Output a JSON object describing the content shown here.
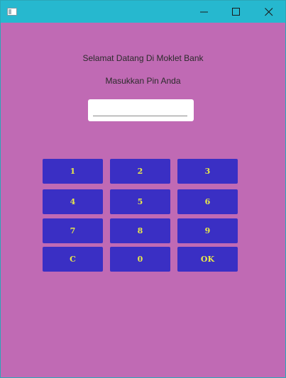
{
  "window": {
    "icon": "app-window-icon",
    "controls": [
      "minimize-icon",
      "maximize-icon",
      "close-icon"
    ]
  },
  "screen": {
    "welcome": "Selamat Datang Di Moklet Bank",
    "prompt": "Masukkan Pin Anda",
    "pin_value": ""
  },
  "keypad": {
    "k1": "1",
    "k2": "2",
    "k3": "3",
    "k4": "4",
    "k5": "5",
    "k6": "6",
    "k7": "7",
    "k8": "8",
    "k9": "9",
    "clear": "C",
    "k0": "0",
    "ok": "OK"
  },
  "colors": {
    "titlebar": "#26b8cf",
    "background": "#c06ab4",
    "key_background": "#3a2fc4",
    "key_text": "#e8e84a"
  }
}
